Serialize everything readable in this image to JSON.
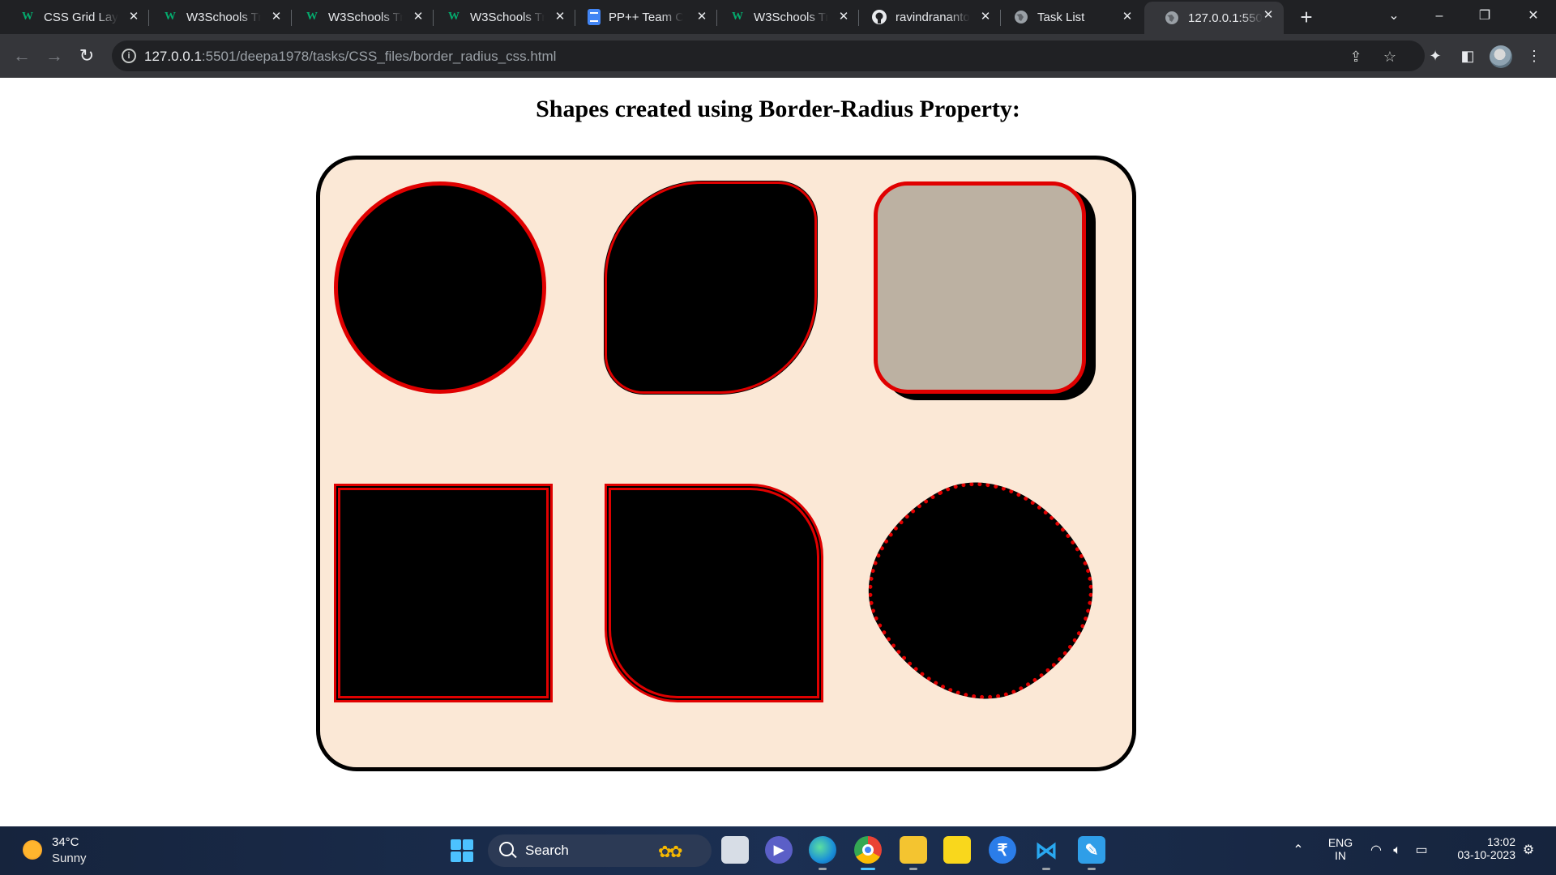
{
  "browser": {
    "tabs": [
      {
        "title": "CSS Grid Layout",
        "favicon": "w3schools-icon"
      },
      {
        "title": "W3Schools Tryit",
        "favicon": "w3schools-icon"
      },
      {
        "title": "W3Schools Tryit",
        "favicon": "w3schools-icon"
      },
      {
        "title": "W3Schools Tryit",
        "favicon": "w3schools-icon"
      },
      {
        "title": "PP++ Team Collab",
        "favicon": "google-docs-icon"
      },
      {
        "title": "W3Schools Tryit",
        "favicon": "w3schools-icon"
      },
      {
        "title": "ravindranantotal",
        "favicon": "github-icon"
      },
      {
        "title": "Task List",
        "favicon": "globe-icon"
      },
      {
        "title": "127.0.0.1:5501",
        "favicon": "globe-icon",
        "active": true
      }
    ],
    "url_host": "127.0.0.1",
    "url_rest": ":5501/deepa1978/tasks/CSS_files/border_radius_css.html"
  },
  "page": {
    "heading": "Shapes created using Border-Radius Property:"
  },
  "colors": {
    "panel_bg": "#fbe8d6",
    "shape_fill": "#000000",
    "border_red": "#e00000",
    "rounded_square_fill": "#bcb1a2"
  },
  "taskbar": {
    "weather_temp": "34°C",
    "weather_cond": "Sunny",
    "search_label": "Search",
    "lang_top": "ENG",
    "lang_bottom": "IN",
    "time": "13:02",
    "date": "03-10-2023"
  }
}
